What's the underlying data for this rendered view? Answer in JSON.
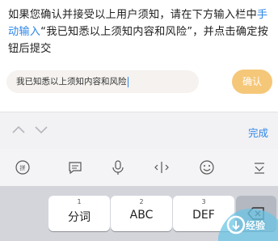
{
  "instruction": {
    "part1": "如果您确认并接受以上用户须知，请在下方输入栏中",
    "link": "手动输入",
    "part2": "“我已知悉以上须知内容和风险”，并点击确定按钮后提交"
  },
  "input": {
    "value": "我已知悉以上须知内容和风险"
  },
  "confirm_label": "确认",
  "toolbar": {
    "prev_icon": "chevron-up-icon",
    "next_icon": "chevron-down-icon",
    "done_label": "完成"
  },
  "quickbar": {
    "icons": [
      "keyboard-switch-icon",
      "chat-icon",
      "microphone-icon",
      "cursor-move-icon",
      "emoji-icon",
      "hide-keyboard-icon"
    ]
  },
  "keyboard": {
    "keys": [
      {
        "num": "1",
        "label": "分词"
      },
      {
        "num": "2",
        "label": "ABC"
      },
      {
        "num": "3",
        "label": "DEF"
      }
    ],
    "delete_icon": "backspace-icon"
  },
  "watermark": {
    "text": "经验"
  },
  "colors": {
    "link": "#2f86e8",
    "confirm_bg": "#f5c778",
    "keyboard_bg": "#d3d5db"
  }
}
